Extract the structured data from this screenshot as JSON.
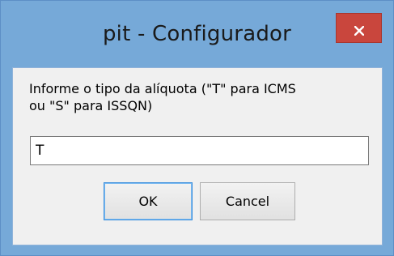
{
  "window": {
    "title": "pit - Configurador",
    "close_icon": "close-icon"
  },
  "dialog": {
    "prompt": "Informe o tipo da alíquota (\"T\" para ICMS\nou \"S\" para ISSQN)",
    "input_value": "T",
    "ok_label": "OK",
    "cancel_label": "Cancel"
  },
  "colors": {
    "frame": "#76a9d8",
    "close_button": "#c9463d",
    "client_bg": "#f0f0f0",
    "default_button_border": "#3c8fdd"
  }
}
